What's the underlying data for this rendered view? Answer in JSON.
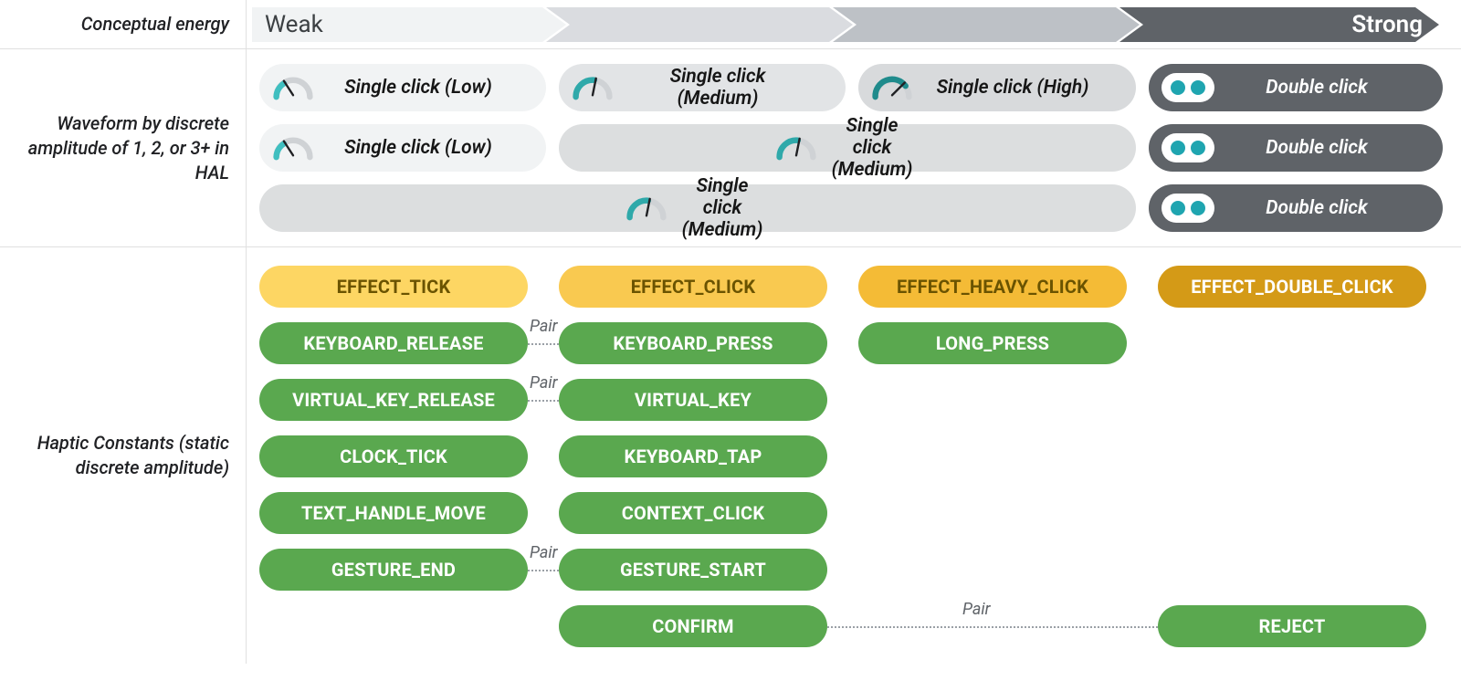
{
  "sections": {
    "energy_label": "Conceptual energy",
    "waveform_label": "Waveform by discrete amplitude of 1, 2, or 3+ in HAL",
    "constants_label": "Haptic Constants (static discrete amplitude)"
  },
  "arrow": {
    "weak": "Weak",
    "strong": "Strong"
  },
  "waveform": {
    "single_low": "Single click (Low)",
    "single_med": "Single click (Medium)",
    "single_high": "Single click (High)",
    "double": "Double click"
  },
  "effects": {
    "tick": "EFFECT_TICK",
    "click": "EFFECT_CLICK",
    "heavy": "EFFECT_HEAVY_CLICK",
    "double": "EFFECT_DOUBLE_CLICK"
  },
  "constants": {
    "c1": [
      "KEYBOARD_RELEASE",
      "KEYBOARD_PRESS",
      "LONG_PRESS",
      ""
    ],
    "c2": [
      "VIRTUAL_KEY_RELEASE",
      "VIRTUAL_KEY",
      "",
      ""
    ],
    "c3": [
      "CLOCK_TICK",
      "KEYBOARD_TAP",
      "",
      ""
    ],
    "c4": [
      "TEXT_HANDLE_MOVE",
      "CONTEXT_CLICK",
      "",
      ""
    ],
    "c5": [
      "GESTURE_END",
      "GESTURE_START",
      "",
      ""
    ],
    "c6": [
      "",
      "CONFIRM",
      "",
      "REJECT"
    ]
  },
  "pair_label": "Pair"
}
